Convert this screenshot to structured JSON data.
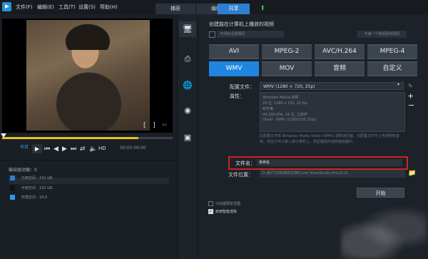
{
  "menu": {
    "file": "文件(F)",
    "edit": "编辑(E)",
    "tools": "工具(T)",
    "settings": "设置(S)",
    "help": "帮助(H)"
  },
  "tabs": [
    {
      "label": "捕获",
      "active": false
    },
    {
      "label": "编辑",
      "active": false
    },
    {
      "label": "共享",
      "active": true
    }
  ],
  "player": {
    "mode_label": "项目",
    "hd_label": "HD",
    "timecode": "00:00:00:00",
    "progress": 0.8
  },
  "output": {
    "drive_label": "输出驱动器：0",
    "disks": [
      {
        "label": "已用空间 - 741 GB",
        "color": "#2d7fd0"
      },
      {
        "label": "可用空间 - 155 GB",
        "color": "#0f1216"
      },
      {
        "label": "所需空间 - 16.8",
        "color": "#1ea0e8"
      }
    ]
  },
  "share": {
    "title": "创建能在计算机上播放的视频",
    "select_left": "与项目设置相同",
    "select_right": "与第一个视频素材相同",
    "formats": [
      {
        "label": "AVI",
        "selected": false
      },
      {
        "label": "MPEG-2",
        "selected": false
      },
      {
        "label": "AVC/H.264",
        "selected": false
      },
      {
        "label": "MPEG-4",
        "selected": false
      },
      {
        "label": "WMV",
        "selected": true
      },
      {
        "label": "MOV",
        "selected": false
      },
      {
        "label": "音频",
        "selected": false
      },
      {
        "label": "自定义",
        "selected": false
      }
    ],
    "config_label": "配置文件：",
    "config_value": "WMV (1280 × 720, 25p)",
    "props_label": "属性：",
    "props_lines": [
      "Windows Media 视频",
      "24 位, 1280 x 720, 25 fps",
      "帧字格",
      "44,100 KHz, 16 位, 立体声",
      "(Vivid - WMV (1280x720 25p))"
    ],
    "description": "此配置文件将 Windows Media Video (WMV) 视频流压缩，在配置文件中上传视频和音频，现在它可以移入到计算机上，然后播放的视频播放器中。",
    "filename_label": "文件名：",
    "filename_value": "未命名",
    "location_label": "文件位置：",
    "location_value": "D:\\用户\\文档\\我的文档\\Corel VideoStudio Pro\\22.0\\",
    "opt1_label": "只创建预览范围",
    "opt2_label": "启用智能渲染",
    "start_label": "开始"
  }
}
